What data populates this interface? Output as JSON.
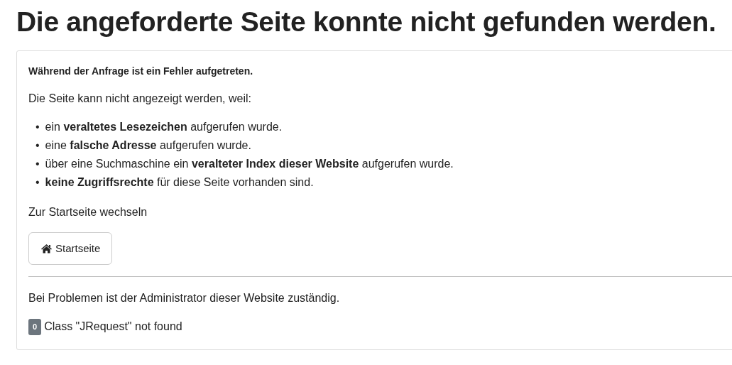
{
  "heading": "Die angeforderte Seite konnte nicht gefunden werden.",
  "card": {
    "error_title": "Während der Anfrage ist ein Fehler aufgetreten.",
    "intro": "Die Seite kann nicht angezeigt werden, weil:",
    "reasons": [
      {
        "bullet": "•",
        "text": "ein **veraltetes Lesezeichen** aufgerufen wurde."
      },
      {
        "bullet": "•",
        "text": "eine **falsche Adresse** aufgerufen wurde."
      },
      {
        "bullet": "•",
        "text": "über eine Suchmaschine ein **veralteter Index dieser Website** aufgerufen wurde."
      },
      {
        "bullet": "•",
        "text": "**keine Zugriffsrechte** für diese Seite vorhanden sind."
      }
    ],
    "home_prompt": "Zur Startseite wechseln",
    "home_button": "Startseite",
    "contact": "Bei Problemen ist der Administrator dieser Website zuständig.",
    "error_code": "0",
    "error_message": "Class \"JRequest\" not found"
  }
}
